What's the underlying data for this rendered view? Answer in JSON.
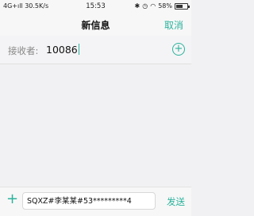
{
  "status_bar": {
    "left": "4G+ıll 30.5K/s",
    "time": "15:53",
    "battery": "58%",
    "battery_level": 0.58
  },
  "header": {
    "title": "新信息",
    "cancel_label": "取消"
  },
  "recipient": {
    "label": "接收者:",
    "value": "10086"
  },
  "composer": {
    "text": "SQXZ#李某某#53*********4",
    "send_label": "发送"
  },
  "colors": {
    "accent": "#2bb39c"
  }
}
